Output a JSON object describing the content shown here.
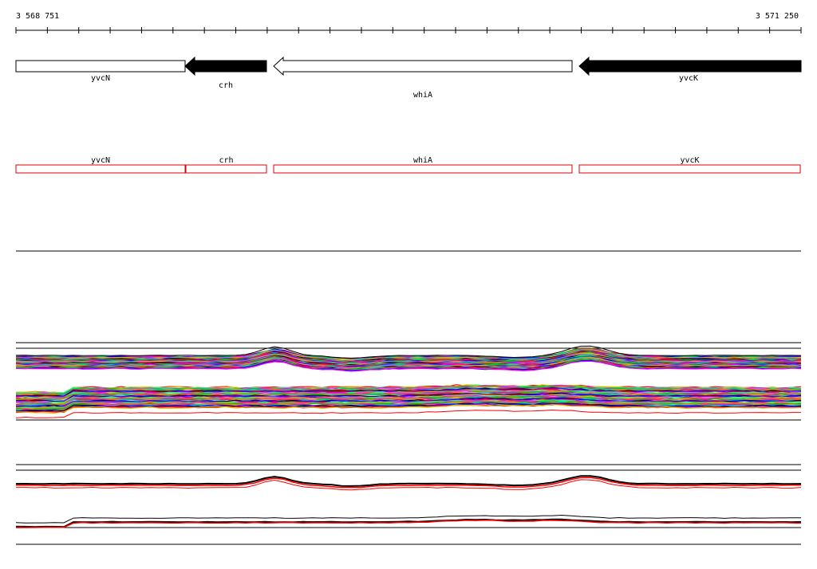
{
  "ruler": {
    "start_label": "3 568 751",
    "end_label": "3 571 250"
  },
  "genes": [
    {
      "name": "yvcN",
      "strand": "+",
      "style": "open"
    },
    {
      "name": "crh",
      "strand": "-",
      "style": "filled"
    },
    {
      "name": "whiA",
      "strand": "-",
      "style": "open"
    },
    {
      "name": "yvcK",
      "strand": "-",
      "style": "filled"
    }
  ],
  "annotations": [
    {
      "name": "yvcN"
    },
    {
      "name": "crh"
    },
    {
      "name": "whiA"
    },
    {
      "name": "yvcK"
    }
  ],
  "colors": {
    "gene_stroke": "#000000",
    "annotation_box": "#dd0000",
    "profile_highlight": "#ff0000",
    "profile_palette": [
      "#ff0000",
      "#00cc00",
      "#0000ff",
      "#ff00ff",
      "#00cccc",
      "#cccc00",
      "#ff8800",
      "#8800ff",
      "#888888",
      "#000000",
      "#00ff88",
      "#ff0088"
    ]
  }
}
